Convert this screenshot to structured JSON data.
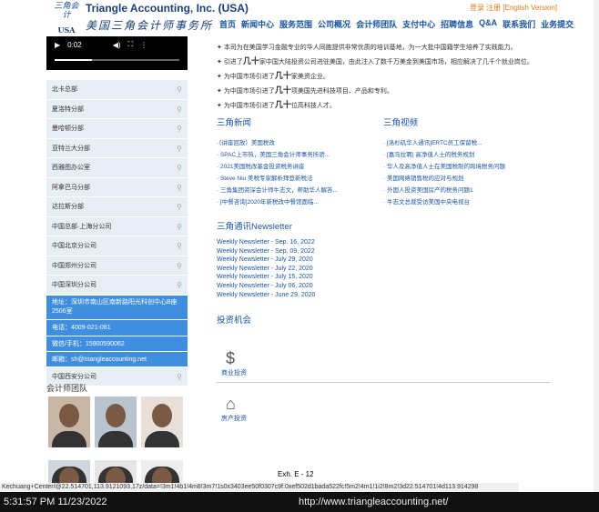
{
  "header": {
    "logo_cn_small": "三角会计",
    "logo_usa": "USA",
    "logo_en": "Triangle Accounting, Inc. (USA)",
    "logo_cn": "美国三角会计师事务所",
    "top_links": "登录 注册 [English Version]",
    "nav": [
      "首页",
      "新闻中心",
      "服务范围",
      "公司概况",
      "会计师团队",
      "支付中心",
      "招聘信息",
      "Q&A",
      "联系我们",
      "业务提交"
    ]
  },
  "video": {
    "time": "0:02"
  },
  "sidebar": {
    "items_top": [
      "北卡总部",
      "夏洛特分部",
      "曼哈顿分部",
      "亚特兰大分部",
      "西雅图办公室",
      "阿拿巴马分部",
      "达拉斯分部",
      "中国总部·上海分公司",
      "中国北京分公司",
      "中国郑州分公司",
      "中国深圳分公司"
    ],
    "contact": {
      "address": "地址：深圳市南山区南新路阳光科创中心B座2506室",
      "phone": "电话：4009-021-081",
      "wechat": "微信/手机：15900590062",
      "email": "邮箱：sh@triangleaccounting.net"
    },
    "item_last": "中国西安分公司",
    "team_title": "会计师团队"
  },
  "main": {
    "bullets": [
      {
        "pre": "本司为在美国学习金融专业的华人同胞提供非常优质的培训基地，为一大批中国籍学生培养了实践能力。",
        "bold": "",
        "post": ""
      },
      {
        "pre": "引进了",
        "bold": "几十",
        "post": "家中国大陆投资公司进驻美国，由此注入了数千万美金到美国市场，相应解决了几千个就业岗位。"
      },
      {
        "pre": "为中国市场引进了",
        "bold": "几十",
        "post": "家美资企业。"
      },
      {
        "pre": "为中国市场引进了",
        "bold": "几十",
        "post": "项美国先进科技项目、产品和专利。"
      },
      {
        "pre": "为中国市场引进了",
        "bold": "几十",
        "post": "位高科技人才。"
      }
    ],
    "news_title": "三角新闻",
    "news": [
      "·（讲座回放）美国税改",
      "· SPAC上市热，美国三角会计师事务所骄...",
      "· 2021美国税改基金投资税务讲座",
      "· Steve Niu 美税专家解析拜登新税法",
      "· 三角集团资深会计师牛志文，帮助华人解答...",
      "· [中餐咨询]2020年新税改中餐馆面临..."
    ],
    "video_title": "三角视频",
    "videos": [
      "· [洛杉矶华人通讯]ERTC员工保留税...",
      "· [嘉马拉聘] 高净值人士的税务规划",
      "· 华人及高净值人士在美国税制的跨境税务问题",
      "· 美国网络销售税的应对与规划",
      "· 外国人投资美国房产的税务问题1",
      "· 牛志文总裁受访美国中央电视台"
    ],
    "newsletter_title": "三角通讯Newsletter",
    "newsletters": [
      "Weekly Newsletter - Sep. 16, 2022",
      "Weekly Newsletter - Sep. 09, 2022",
      "Weekly Newsletter - July 29, 2020",
      "Weekly Newsletter - July 22, 2020",
      "Weekly Newsletter - July 15, 2020",
      "Weekly Newsletter - July 06, 2020",
      "Weekly Newsletter - June 29, 2020"
    ],
    "invest_title": "投资机会",
    "invest_items": [
      "商业投资",
      "房产投资"
    ]
  },
  "exhibit": "Exh. E - 12",
  "status_url": "Kechuang+Center/@22.514701,113.9121093,17z/data=!3m1!4b1!4m8!3m7!1s0x3403ee50f0307c9f:0xef502d1bada522fc!5m2!4m1!1i2!8m2!3d22.514701!4d113.914298",
  "footer": {
    "timestamp": "5:31:57 PM 11/23/2022",
    "url": "http://www.triangleaccounting.net/"
  }
}
